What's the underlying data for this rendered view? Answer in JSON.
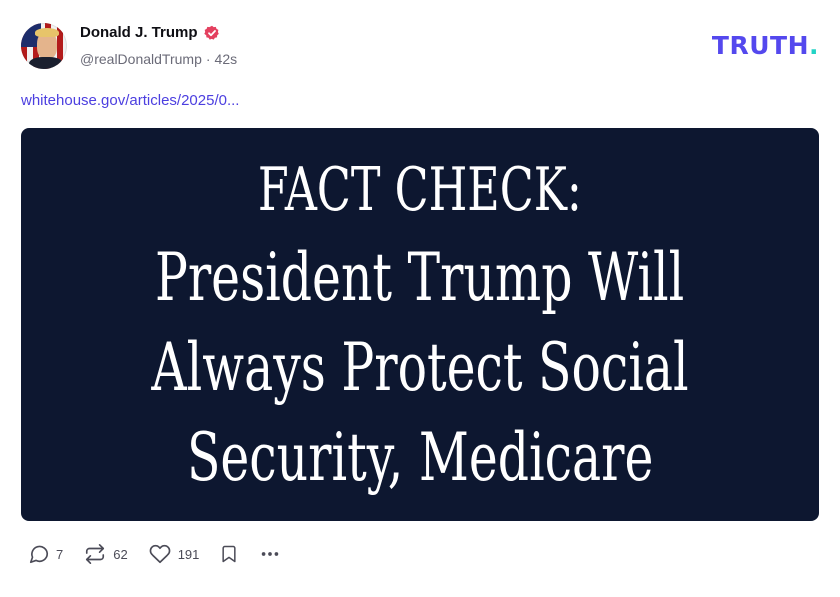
{
  "post": {
    "author": {
      "display_name": "Donald J. Trump",
      "handle": "@realDonaldTrump",
      "separator": "·",
      "time_ago": "42s",
      "verified": true
    },
    "link_text": "whitehouse.gov/articles/2025/0...",
    "image": {
      "headline_lines": [
        "FACT CHECK:",
        "President Trump Will",
        "Always Protect Social",
        "Security, Medicare"
      ],
      "background_color": "#0d1730",
      "text_color": "#ffffff"
    },
    "actions": {
      "reply_count": "7",
      "retruth_count": "62",
      "like_count": "191"
    }
  },
  "brand": {
    "logo_text": "TRUTH",
    "logo_dot": ".",
    "logo_color": "#5448ee",
    "dot_color": "#22d3c5"
  },
  "icons": {
    "verified": "verified-badge-icon",
    "reply": "comment-icon",
    "retruth": "retruth-icon",
    "like": "heart-icon",
    "bookmark": "bookmark-icon",
    "more": "more-dots-icon"
  },
  "colors": {
    "accent": "#4c3fe0",
    "verified_badge": "#e4405f",
    "muted_text": "#6b6b78"
  }
}
